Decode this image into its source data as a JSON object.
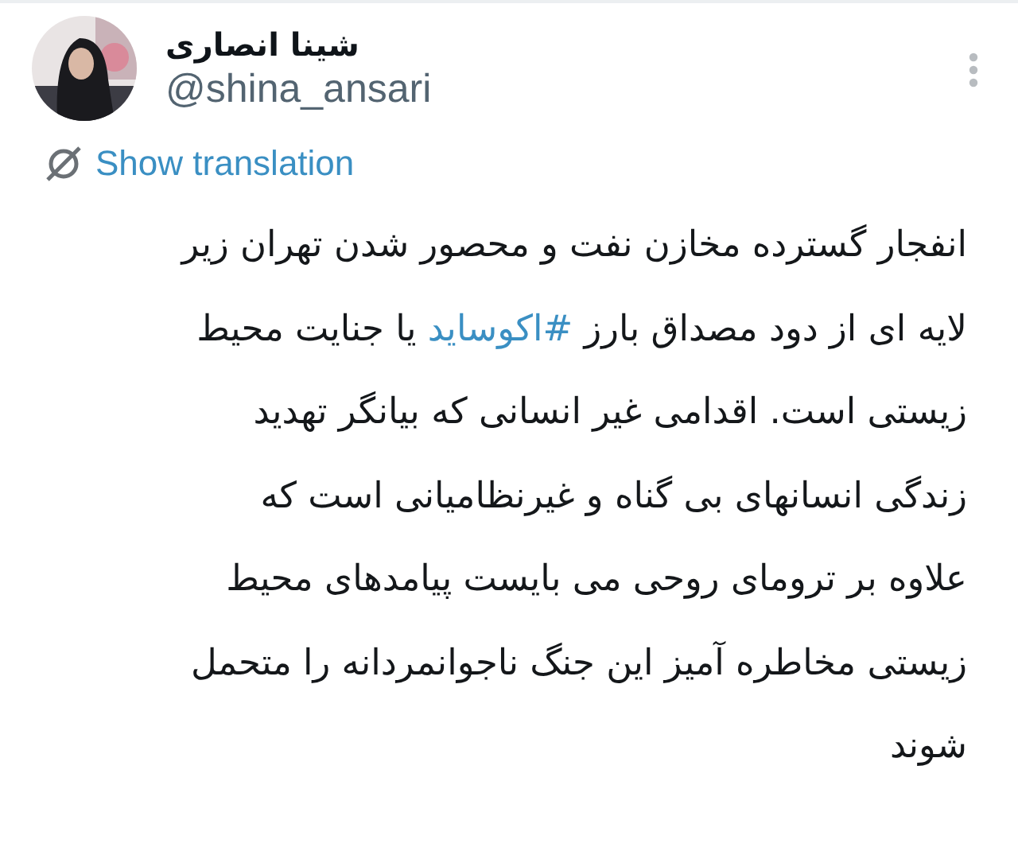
{
  "author": {
    "name": "شینا انصاری",
    "handle": "@shina_ansari"
  },
  "translation_link": "Show translation",
  "body": {
    "lines": [
      [
        {
          "kind": "text",
          "text": "انفجار گسترده مخازن نفت و محصور شدن تهران زیر"
        }
      ],
      [
        {
          "kind": "text",
          "text": "لایه ای از دود مصداق بارز "
        },
        {
          "kind": "hashtag",
          "text": "#اکوساید"
        },
        {
          "kind": "text",
          "text": " یا جنایت محیط"
        }
      ],
      [
        {
          "kind": "text",
          "text": "زیستی است. اقدامی غیر انسانی که بیانگر تهدید"
        }
      ],
      [
        {
          "kind": "text",
          "text": "زندگی انسانهای بی گناه و غیرنظامیانی است که"
        }
      ],
      [
        {
          "kind": "text",
          "text": "علاوه بر ترومای روحی می بایست پیامدهای محیط"
        }
      ],
      [
        {
          "kind": "text",
          "text": "زیستی مخاطره آمیز این جنگ ناجوانمردانه را متحمل"
        }
      ],
      [
        {
          "kind": "text",
          "text": "شوند"
        }
      ]
    ]
  }
}
